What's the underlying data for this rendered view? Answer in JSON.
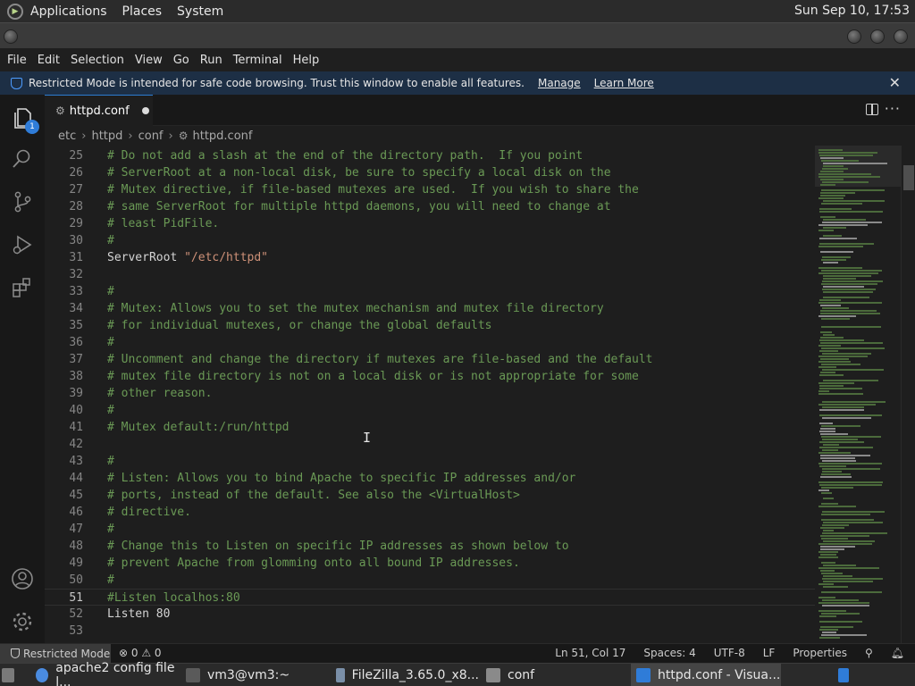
{
  "panel": {
    "menus": [
      "Applications",
      "Places",
      "System"
    ],
    "clock": "Sun Sep 10, 17:53"
  },
  "menubar": [
    "File",
    "Edit",
    "Selection",
    "View",
    "Go",
    "Run",
    "Terminal",
    "Help"
  ],
  "banner": {
    "text": "Restricted Mode is intended for safe code browsing. Trust this window to enable all features.",
    "manage": "Manage",
    "learn_more": "Learn More",
    "close": "✕"
  },
  "activity": {
    "explorer_badge": "1"
  },
  "tab": {
    "name": "httpd.conf",
    "more": "···"
  },
  "breadcrumb": [
    "etc",
    "httpd",
    "conf",
    "httpd.conf"
  ],
  "editor": {
    "lines": [
      {
        "n": "25",
        "t": "# Do not add a slash at the end of the directory path.  If you point",
        "k": "cmt"
      },
      {
        "n": "26",
        "t": "# ServerRoot at a non-local disk, be sure to specify a local disk on the",
        "k": "cmt"
      },
      {
        "n": "27",
        "t": "# Mutex directive, if file-based mutexes are used.  If you wish to share the",
        "k": "cmt"
      },
      {
        "n": "28",
        "t": "# same ServerRoot for multiple httpd daemons, you will need to change at",
        "k": "cmt"
      },
      {
        "n": "29",
        "t": "# least PidFile.",
        "k": "cmt"
      },
      {
        "n": "30",
        "t": "#",
        "k": "cmt"
      },
      {
        "n": "31",
        "t": "ServerRoot \"/etc/httpd\"",
        "k": "dir"
      },
      {
        "n": "32",
        "t": "",
        "k": "dir"
      },
      {
        "n": "33",
        "t": "#",
        "k": "cmt"
      },
      {
        "n": "34",
        "t": "# Mutex: Allows you to set the mutex mechanism and mutex file directory",
        "k": "cmt"
      },
      {
        "n": "35",
        "t": "# for individual mutexes, or change the global defaults",
        "k": "cmt"
      },
      {
        "n": "36",
        "t": "#",
        "k": "cmt"
      },
      {
        "n": "37",
        "t": "# Uncomment and change the directory if mutexes are file-based and the default",
        "k": "cmt"
      },
      {
        "n": "38",
        "t": "# mutex file directory is not on a local disk or is not appropriate for some",
        "k": "cmt"
      },
      {
        "n": "39",
        "t": "# other reason.",
        "k": "cmt"
      },
      {
        "n": "40",
        "t": "#",
        "k": "cmt"
      },
      {
        "n": "41",
        "t": "# Mutex default:/run/httpd",
        "k": "cmt"
      },
      {
        "n": "42",
        "t": "",
        "k": "dir"
      },
      {
        "n": "43",
        "t": "#",
        "k": "cmt"
      },
      {
        "n": "44",
        "t": "# Listen: Allows you to bind Apache to specific IP addresses and/or",
        "k": "cmt"
      },
      {
        "n": "45",
        "t": "# ports, instead of the default. See also the <VirtualHost>",
        "k": "cmt"
      },
      {
        "n": "46",
        "t": "# directive.",
        "k": "cmt"
      },
      {
        "n": "47",
        "t": "#",
        "k": "cmt"
      },
      {
        "n": "48",
        "t": "# Change this to Listen on specific IP addresses as shown below to",
        "k": "cmt"
      },
      {
        "n": "49",
        "t": "# prevent Apache from glomming onto all bound IP addresses.",
        "k": "cmt"
      },
      {
        "n": "50",
        "t": "#",
        "k": "cmt"
      },
      {
        "n": "51",
        "t": "#Listen localhos:80",
        "k": "cmt",
        "cur": true
      },
      {
        "n": "52",
        "t": "Listen 80",
        "k": "dir"
      },
      {
        "n": "53",
        "t": "",
        "k": "dir"
      }
    ]
  },
  "status": {
    "restricted": "Restricted Mode",
    "problems": "⊗ 0 ⚠ 0",
    "position": "Ln 51, Col 17",
    "spaces": "Spaces: 4",
    "encoding": "UTF-8",
    "eol": "LF",
    "language": "Properties"
  },
  "taskbar": [
    {
      "label": "apache2 config file l...",
      "icon": "chrome-icon",
      "color": "#4a8be0"
    },
    {
      "label": "vm3@vm3:~",
      "icon": "terminal-icon",
      "color": "#5a5a5a"
    },
    {
      "label": "FileZilla_3.65.0_x8...",
      "icon": "filezilla-icon",
      "color": "#7a8fa8"
    },
    {
      "label": "conf",
      "icon": "folder-icon",
      "color": "#8a8a8a"
    },
    {
      "label": "httpd.conf - Visua...",
      "icon": "vscode-icon",
      "color": "#2f7cd8",
      "active": true
    }
  ]
}
